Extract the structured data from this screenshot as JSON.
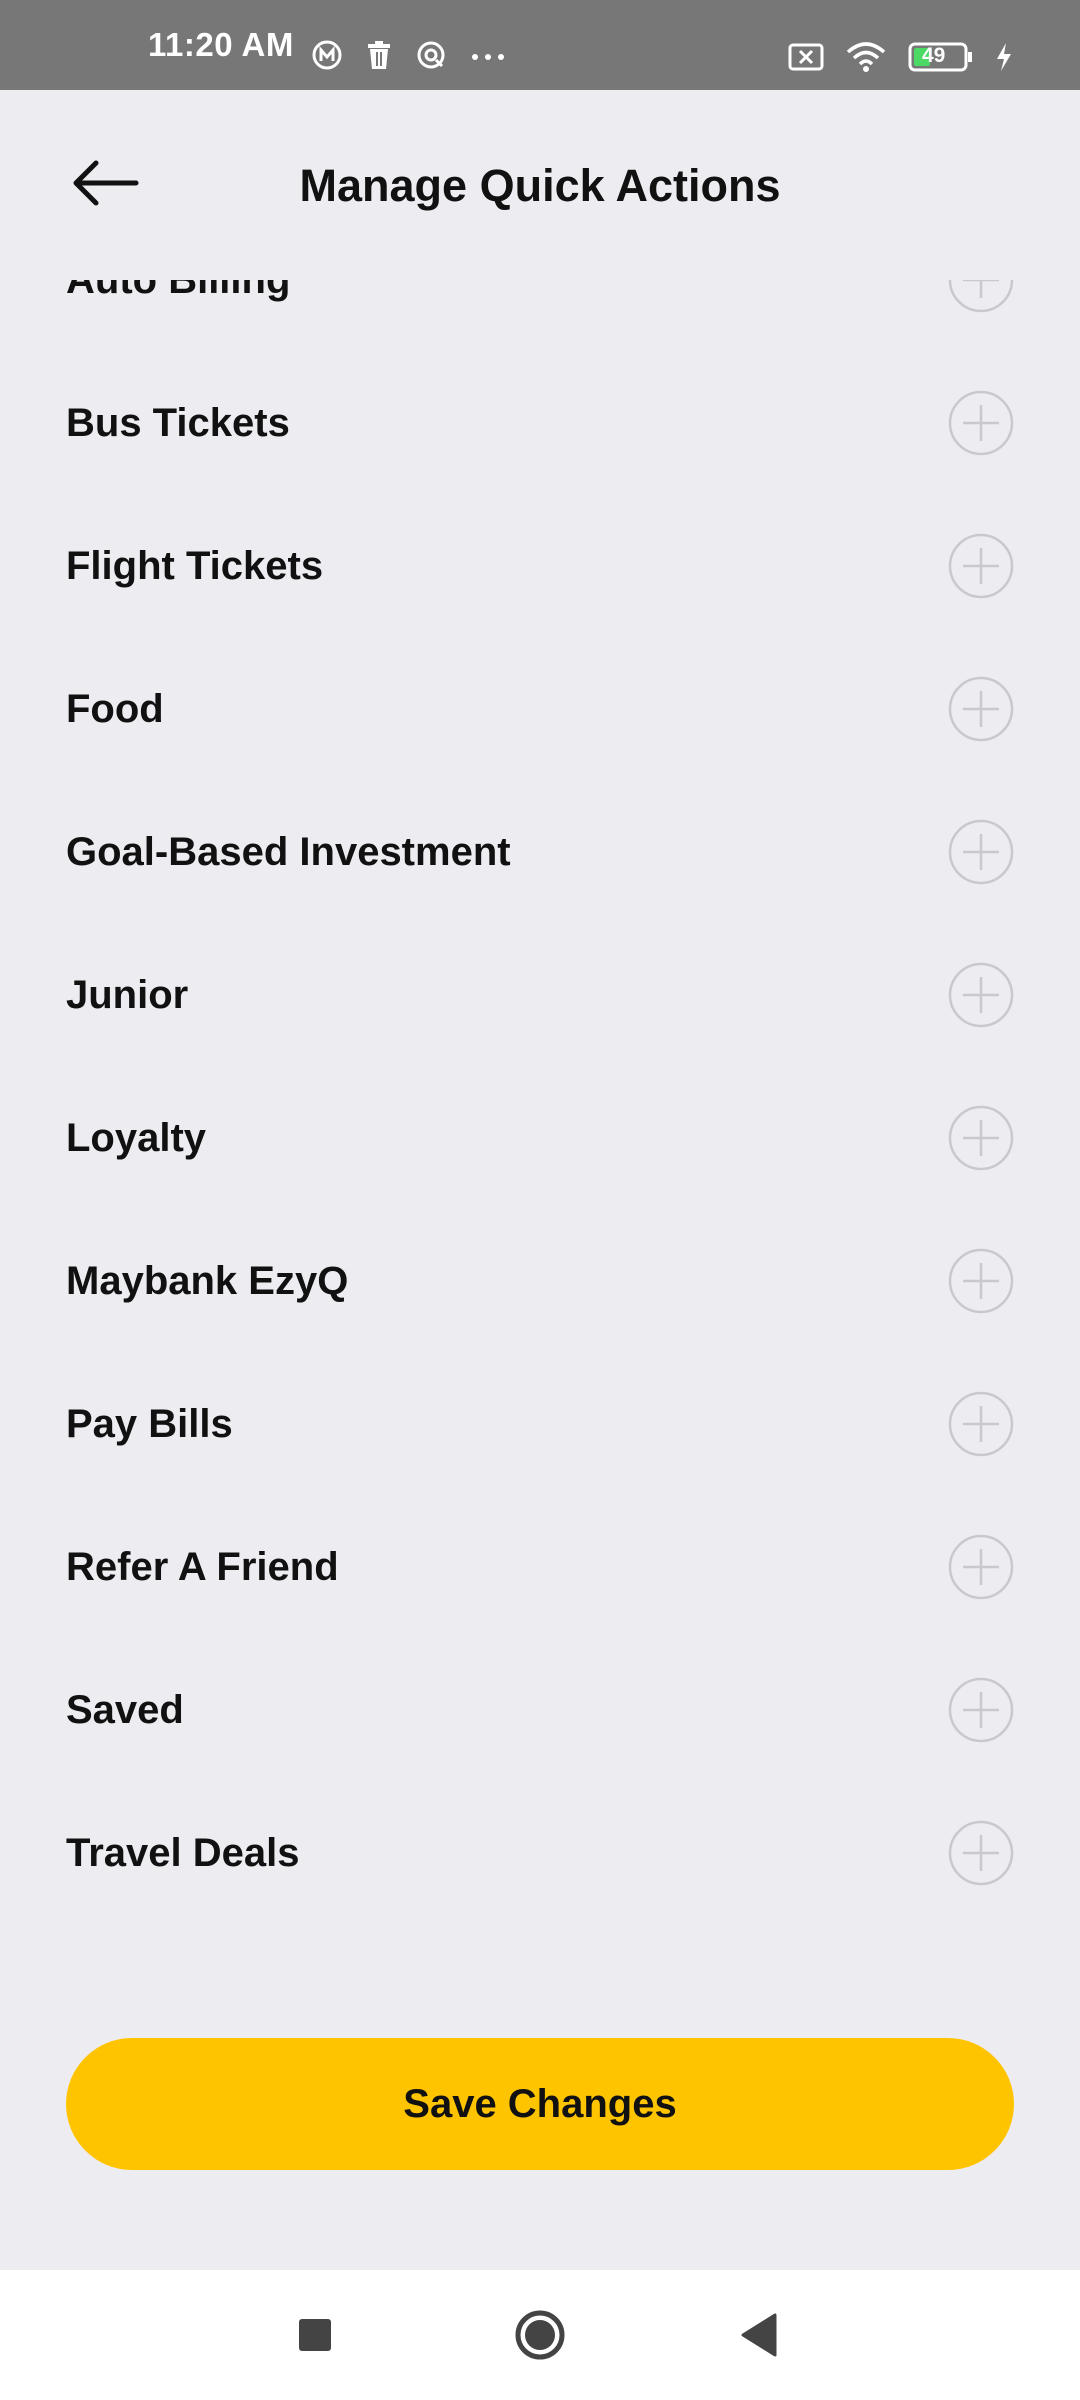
{
  "status_bar": {
    "time": "11:20 AM",
    "battery_level": "49",
    "left_icons": [
      "maybank-m-icon",
      "trash-icon",
      "vpn-icon",
      "more-dots-icon"
    ],
    "right_icons": [
      "sim-x-icon",
      "wifi-icon",
      "battery-icon",
      "charging-icon"
    ]
  },
  "header": {
    "title": "Manage Quick Actions",
    "back_icon": "arrow-left-icon"
  },
  "actions": [
    {
      "label": "Auto Billing"
    },
    {
      "label": "Bus Tickets"
    },
    {
      "label": "Flight Tickets"
    },
    {
      "label": "Food"
    },
    {
      "label": "Goal-Based Investment"
    },
    {
      "label": "Junior"
    },
    {
      "label": "Loyalty"
    },
    {
      "label": "Maybank EzyQ"
    },
    {
      "label": "Pay Bills"
    },
    {
      "label": "Refer A Friend"
    },
    {
      "label": "Saved"
    },
    {
      "label": "Travel Deals"
    }
  ],
  "save_button": {
    "label": "Save Changes"
  },
  "nav": {
    "icons": [
      "recents-square-icon",
      "home-circle-icon",
      "back-triangle-icon"
    ]
  },
  "colors": {
    "background": "#edecf1",
    "accent": "#ffc400",
    "status_bar": "#777777",
    "battery_fill": "#4cd964"
  }
}
